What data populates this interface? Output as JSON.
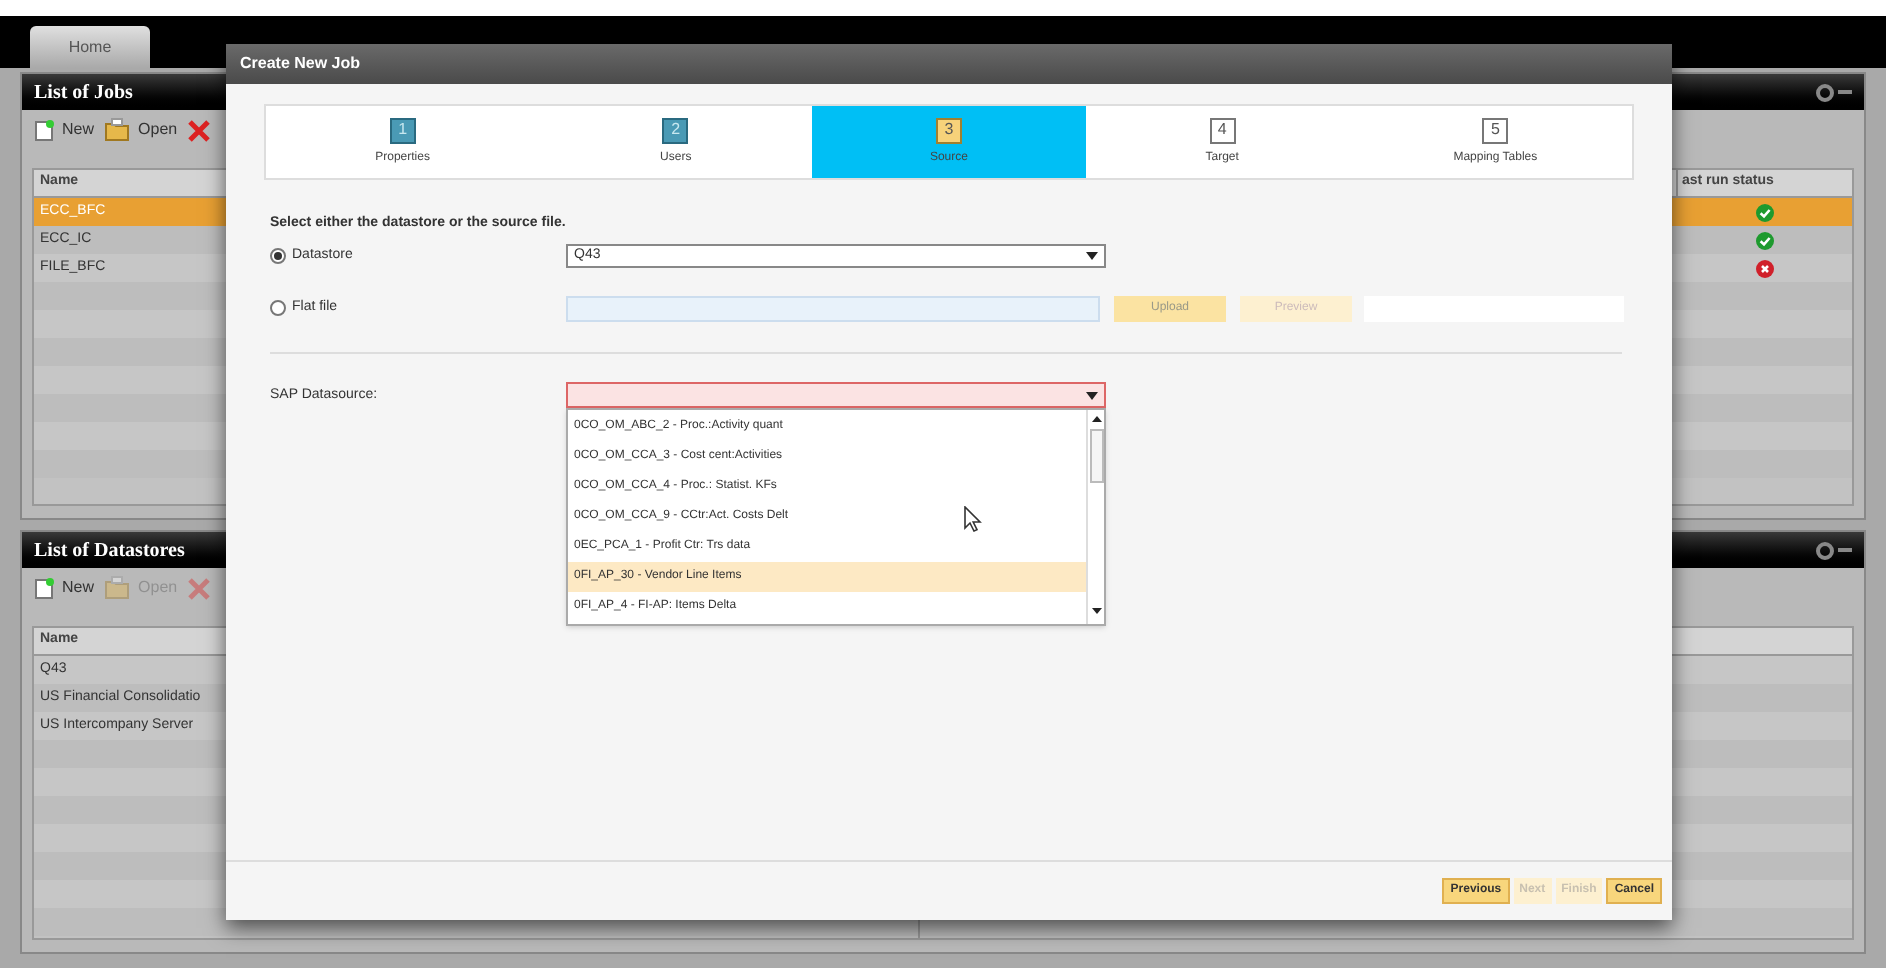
{
  "top_tabs": [
    {
      "label": "Home",
      "selected": true
    }
  ],
  "jobs_panel": {
    "title": "List of Jobs",
    "toolbar": [
      {
        "kind": "new",
        "label": "New",
        "disabled": false
      },
      {
        "kind": "open",
        "label": "Open",
        "disabled": false
      },
      {
        "kind": "delete",
        "disabled": false
      }
    ],
    "columns": [
      "Name",
      "ast run status"
    ],
    "rows": [
      {
        "name": "ECC_BFC",
        "failed": false,
        "selected": true
      },
      {
        "name": "ECC_IC",
        "failed": false,
        "selected": false
      },
      {
        "name": "FILE_BFC",
        "failed": true,
        "selected": false
      }
    ]
  },
  "datastores_panel": {
    "title": "List of Datastores",
    "toolbar": [
      {
        "kind": "new",
        "label": "New",
        "disabled": false
      },
      {
        "kind": "open",
        "label": "Open",
        "disabled": true
      },
      {
        "kind": "delete",
        "disabled": true
      }
    ],
    "columns": [
      "Name"
    ],
    "rows": [
      {
        "name": "Q43",
        "selected": false
      },
      {
        "name": "US Financial Consolidatio",
        "selected": false
      },
      {
        "name": "US Intercompany Server",
        "selected": false
      }
    ]
  },
  "dialog": {
    "title": "Create New Job",
    "steps": [
      {
        "number": "1",
        "label": "Properties",
        "completed": true,
        "selected": false
      },
      {
        "number": "2",
        "label": "Users",
        "completed": true,
        "selected": false
      },
      {
        "number": "3",
        "label": "Source",
        "completed": false,
        "selected": true
      },
      {
        "number": "4",
        "label": "Target",
        "completed": false,
        "selected": false
      },
      {
        "number": "5",
        "label": "Mapping Tables",
        "completed": false,
        "selected": false
      }
    ],
    "instruction": "Select either the datastore or the source file.",
    "source_options": [
      {
        "label": "Datastore",
        "selected": true,
        "value": "Q43"
      },
      {
        "label": "Flat file",
        "selected": false
      }
    ],
    "file_buttons": [
      {
        "label": "Upload",
        "disabled": false
      },
      {
        "label": "Preview",
        "disabled": true
      }
    ],
    "sap_datasource": {
      "label": "SAP Datasource:",
      "invalid": true,
      "options": [
        {
          "label": "0CO_OM_ABC_2 - Proc.:Activity quant",
          "selected": false
        },
        {
          "label": "0CO_OM_CCA_3 - Cost cent:Activities",
          "selected": false
        },
        {
          "label": "0CO_OM_CCA_4 - Proc.: Statist. KFs",
          "selected": false
        },
        {
          "label": "0CO_OM_CCA_9 - CCtr:Act. Costs Delt",
          "selected": false
        },
        {
          "label": "0EC_PCA_1 - Profit Ctr: Trs data",
          "selected": false
        },
        {
          "label": "0FI_AP_30 - Vendor Line Items",
          "selected": true
        },
        {
          "label": "0FI_AP_4 - FI-AP: Items Delta",
          "selected": false
        }
      ]
    },
    "buttons": [
      {
        "label": "Previous",
        "disabled": false
      },
      {
        "label": "Next",
        "disabled": true
      },
      {
        "label": "Finish",
        "disabled": true
      },
      {
        "label": "Cancel",
        "disabled": false
      }
    ]
  }
}
